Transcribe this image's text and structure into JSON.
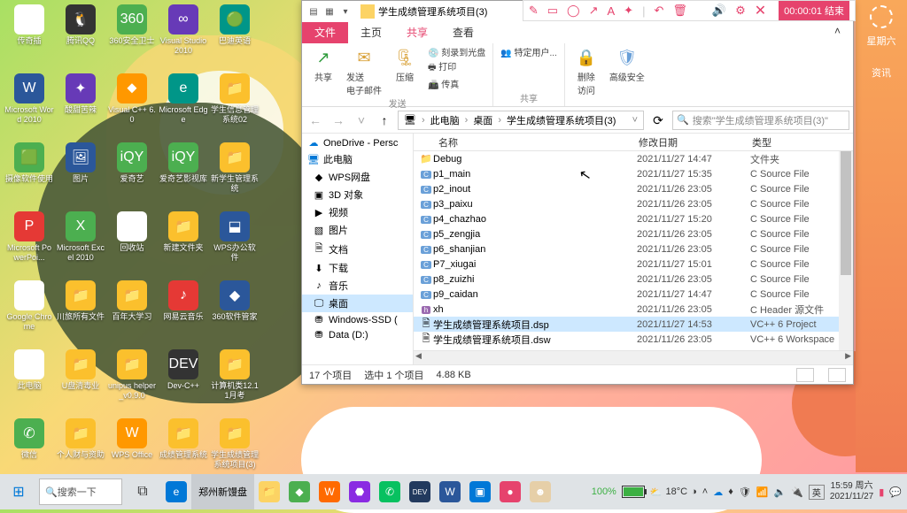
{
  "wallpaper_sidebar": {
    "day": "星期六",
    "info": "资讯"
  },
  "desktop": [
    {
      "label": "传奇插",
      "cls": "ico-white",
      "glyph": "🗑"
    },
    {
      "label": "腾讯QQ",
      "cls": "ico-dark",
      "glyph": "🐧"
    },
    {
      "label": "360安全卫士",
      "cls": "ico-green",
      "glyph": "360"
    },
    {
      "label": "Visual Studio 2010",
      "cls": "ico-purple",
      "glyph": "∞"
    },
    {
      "label": "巴迪英语",
      "cls": "ico-teal",
      "glyph": "🟢"
    },
    {
      "label": "Microsoft Word 2010",
      "cls": "ico-blue",
      "glyph": "W"
    },
    {
      "label": "酸甜苦辣",
      "cls": "ico-purple",
      "glyph": "✦"
    },
    {
      "label": "Visual C++ 6.0",
      "cls": "ico-orange",
      "glyph": "⬥"
    },
    {
      "label": "Microsoft Edge",
      "cls": "ico-teal",
      "glyph": "e"
    },
    {
      "label": "学生信息管理系统02",
      "cls": "ico-yellow",
      "glyph": "📁"
    },
    {
      "label": "摄像软件使用",
      "cls": "ico-green",
      "glyph": "🟩"
    },
    {
      "label": "图片",
      "cls": "ico-blue",
      "glyph": "🖼"
    },
    {
      "label": "爱奇艺",
      "cls": "ico-green",
      "glyph": "iQY"
    },
    {
      "label": "爱奇艺影视库",
      "cls": "ico-green",
      "glyph": "iQY"
    },
    {
      "label": "新学生管理系统",
      "cls": "ico-yellow",
      "glyph": "📁"
    },
    {
      "label": "Microsoft PowerPoi...",
      "cls": "ico-red",
      "glyph": "P"
    },
    {
      "label": "Microsoft Excel 2010",
      "cls": "ico-green",
      "glyph": "X"
    },
    {
      "label": "回收站",
      "cls": "ico-white",
      "glyph": "🗑"
    },
    {
      "label": "新建文件夹",
      "cls": "ico-yellow",
      "glyph": "📁"
    },
    {
      "label": "WPS办公软件",
      "cls": "ico-blue",
      "glyph": "⬓"
    },
    {
      "label": "Google Chrome",
      "cls": "ico-white",
      "glyph": "◎"
    },
    {
      "label": "川旅所有文件",
      "cls": "ico-yellow",
      "glyph": "📁"
    },
    {
      "label": "百年大学习",
      "cls": "ico-yellow",
      "glyph": "📁"
    },
    {
      "label": "网易云音乐",
      "cls": "ico-red",
      "glyph": "♪"
    },
    {
      "label": "360软件管家",
      "cls": "ico-blue",
      "glyph": "◆"
    },
    {
      "label": "此电脑",
      "cls": "ico-white",
      "glyph": "🖥"
    },
    {
      "label": "U盘清毒业",
      "cls": "ico-yellow",
      "glyph": "📁"
    },
    {
      "label": "unipus helper_v0.9.0",
      "cls": "ico-yellow",
      "glyph": "📁"
    },
    {
      "label": "Dev-C++",
      "cls": "ico-dark",
      "glyph": "DEV"
    },
    {
      "label": "计算机类12.11月考",
      "cls": "ico-yellow",
      "glyph": "📁"
    },
    {
      "label": "微信",
      "cls": "ico-green",
      "glyph": "✆"
    },
    {
      "label": "个人财与资助",
      "cls": "ico-yellow",
      "glyph": "📁"
    },
    {
      "label": "WPS Office",
      "cls": "ico-orange",
      "glyph": "W"
    },
    {
      "label": "成绩管理系统",
      "cls": "ico-yellow",
      "glyph": "📁"
    },
    {
      "label": "学生成绩管理系统项目(3)",
      "cls": "ico-yellow",
      "glyph": "📁"
    }
  ],
  "explorer": {
    "title": "学生成绩管理系统项目(3)",
    "tabs": {
      "file": "文件",
      "home": "主页",
      "share": "共享",
      "view": "查看"
    },
    "ribbon": {
      "share_group": {
        "share": "共享",
        "email": "发送\n电子邮件",
        "zip": "压缩",
        "burn": "刻录到光盘",
        "print": "打印",
        "fax": "传真",
        "name": "发送"
      },
      "share2": {
        "specific": "特定用户...",
        "name": "共享"
      },
      "sec": {
        "remove": "删除\n访问",
        "adv": "高级安全"
      }
    },
    "crumbs": [
      "此电脑",
      "桌面",
      "学生成绩管理系统项目(3)"
    ],
    "search_ph": "搜索\"学生成绩管理系统项目(3)\"",
    "nav": [
      {
        "label": "OneDrive - Persc",
        "icon": "☁",
        "l": 1,
        "cls": "nicon-c"
      },
      {
        "label": "此电脑",
        "icon": "🖥",
        "l": 1,
        "cls": "nicon-c"
      },
      {
        "label": "WPS网盘",
        "icon": "◆",
        "l": 2,
        "cls": ""
      },
      {
        "label": "3D 对象",
        "icon": "▣",
        "l": 2,
        "cls": ""
      },
      {
        "label": "视频",
        "icon": "▶",
        "l": 2,
        "cls": ""
      },
      {
        "label": "图片",
        "icon": "▧",
        "l": 2,
        "cls": ""
      },
      {
        "label": "文档",
        "icon": "🗎",
        "l": 2,
        "cls": ""
      },
      {
        "label": "下载",
        "icon": "⬇",
        "l": 2,
        "cls": ""
      },
      {
        "label": "音乐",
        "icon": "♪",
        "l": 2,
        "cls": ""
      },
      {
        "label": "桌面",
        "icon": "🖵",
        "l": 2,
        "cls": "",
        "sel": true
      },
      {
        "label": "Windows-SSD (",
        "icon": "⛃",
        "l": 2,
        "cls": ""
      },
      {
        "label": "Data (D:)",
        "icon": "⛃",
        "l": 2,
        "cls": ""
      }
    ],
    "cols": {
      "name": "名称",
      "date": "修改日期",
      "type": "类型"
    },
    "files": [
      {
        "icon": "📁",
        "name": "Debug",
        "date": "2021/11/27 14:47",
        "type": "文件夹"
      },
      {
        "icon": "c",
        "name": "p1_main",
        "date": "2021/11/27 15:35",
        "type": "C Source File"
      },
      {
        "icon": "c",
        "name": "p2_inout",
        "date": "2021/11/26 23:05",
        "type": "C Source File"
      },
      {
        "icon": "c",
        "name": "p3_paixu",
        "date": "2021/11/26 23:05",
        "type": "C Source File"
      },
      {
        "icon": "c",
        "name": "p4_chazhao",
        "date": "2021/11/27 15:20",
        "type": "C Source File"
      },
      {
        "icon": "c",
        "name": "p5_zengjia",
        "date": "2021/11/26 23:05",
        "type": "C Source File"
      },
      {
        "icon": "c",
        "name": "p6_shanjian",
        "date": "2021/11/26 23:05",
        "type": "C Source File"
      },
      {
        "icon": "c",
        "name": "P7_xiugai",
        "date": "2021/11/27 15:01",
        "type": "C Source File"
      },
      {
        "icon": "c",
        "name": "p8_zuizhi",
        "date": "2021/11/26 23:05",
        "type": "C Source File"
      },
      {
        "icon": "c",
        "name": "p9_caidan",
        "date": "2021/11/27 14:47",
        "type": "C Source File"
      },
      {
        "icon": "h",
        "name": "xh",
        "date": "2021/11/26 23:05",
        "type": "C Header 源文件"
      },
      {
        "icon": "🗎",
        "name": "学生成绩管理系统项目.dsp",
        "date": "2021/11/27 14:53",
        "type": "VC++ 6 Project",
        "sel": true
      },
      {
        "icon": "🗎",
        "name": "学生成绩管理系统项目.dsw",
        "date": "2021/11/26 23:05",
        "type": "VC++ 6 Workspace"
      }
    ],
    "status": {
      "count": "17 个项目",
      "sel": "选中 1 个项目",
      "size": "4.88 KB"
    }
  },
  "recorder": {
    "timer": "00:00:01 结束"
  },
  "taskbar": {
    "search": "搜索一下",
    "weather": {
      "temp": "18°C",
      "hint": "◑"
    },
    "battery": "100%",
    "ime": "英",
    "clock": {
      "time": "15:59 周六",
      "date": "2021/11/27"
    },
    "browser_tab": "郑州新馒盘"
  }
}
